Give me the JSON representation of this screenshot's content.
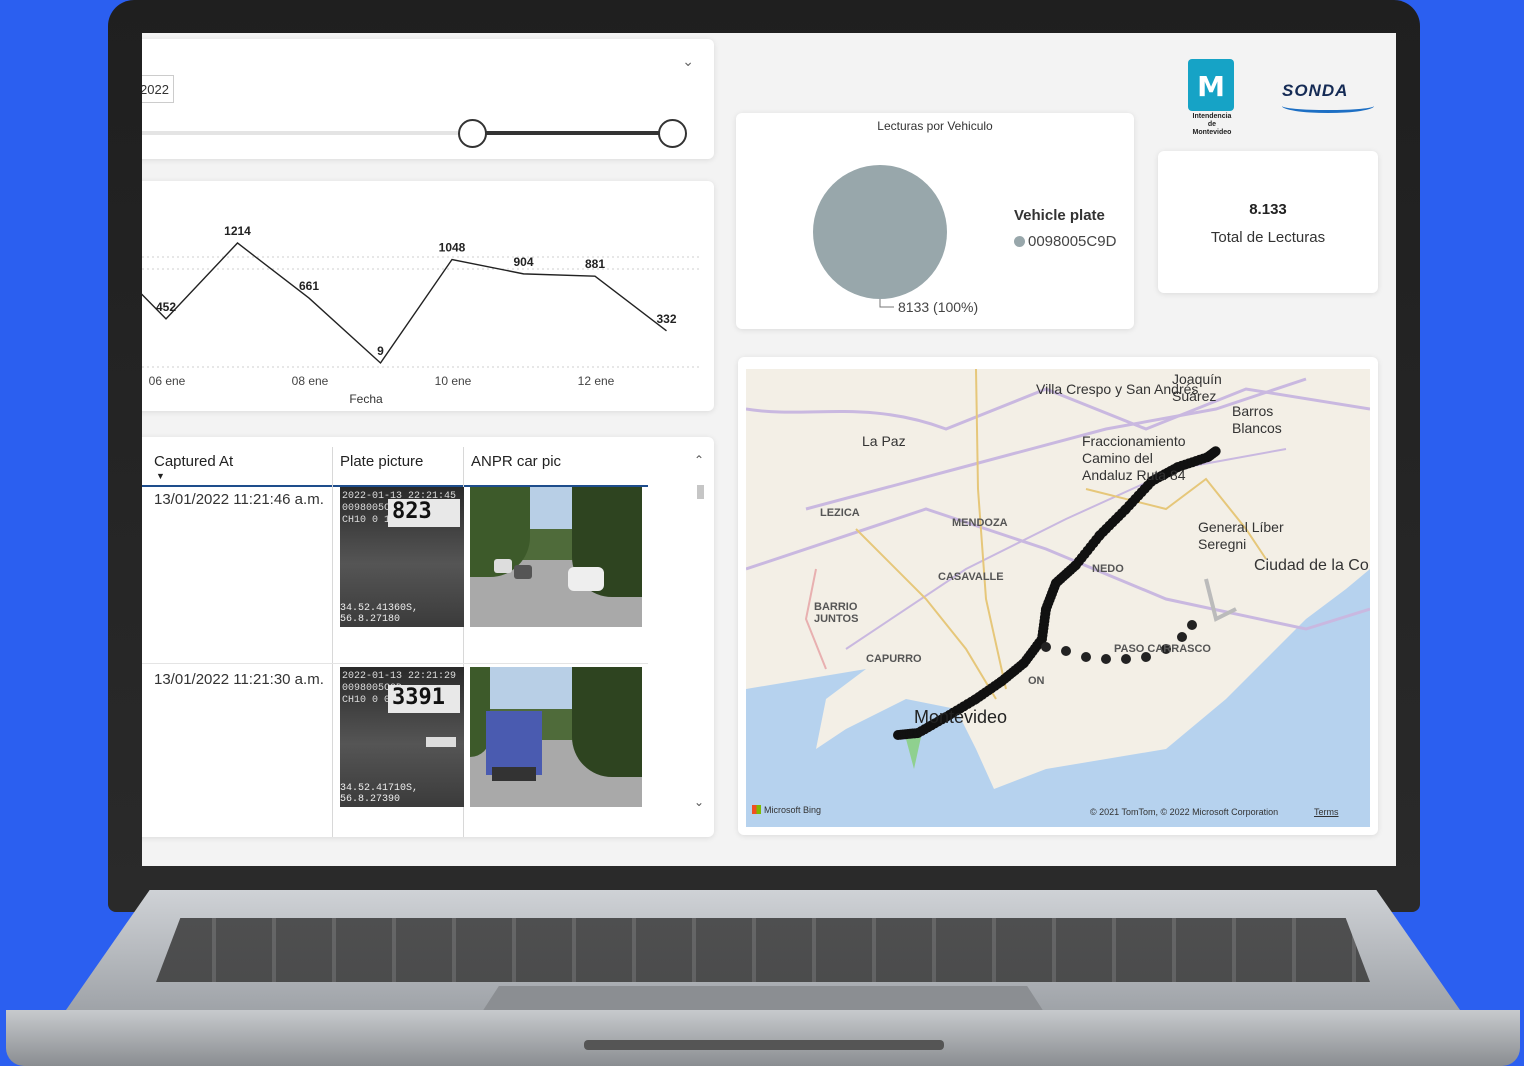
{
  "slicer": {
    "date_fragment": "2022",
    "range": {
      "start_fraction": 0.63,
      "end_fraction": 1.0
    }
  },
  "line_chart": {
    "chart_data": {
      "type": "line",
      "xlabel": "Fecha",
      "tick_labels": [
        "06 ene",
        "08 ene",
        "10 ene",
        "12 ene"
      ],
      "series": [
        {
          "values": [
            452,
            1214,
            661,
            9,
            1048,
            904,
            881,
            332
          ],
          "labels": [
            "452",
            "1214",
            "661",
            "9",
            "1048",
            "904",
            "881",
            "332"
          ]
        }
      ]
    }
  },
  "table": {
    "headers": [
      "Captured At",
      "Plate picture",
      "ANPR car pic"
    ],
    "rows": [
      {
        "captured_at": "13/01/2022 11:21:46 a.m.",
        "plate_ts": "2022-01-13 22:21:45",
        "plate_id": "0098005C9D",
        "plate_info": "CH10 0 13KM/H",
        "plate_number": "823",
        "coords": "34.52.41360S, 56.8.27180"
      },
      {
        "captured_at": "13/01/2022 11:21:30 a.m.",
        "plate_ts": "2022-01-13 22:21:29",
        "plate_id": "0098005C9D",
        "plate_info": "CH10 0 07KM/H",
        "plate_number": "3391",
        "coords": "34.52.41710S, 56.8.27390"
      }
    ]
  },
  "pie": {
    "title": "Lecturas por Vehiculo",
    "legend_title": "Vehicle plate",
    "legend_item": "0098005C9D",
    "slice_label": "8133 (100%)",
    "color": "#98a7ab"
  },
  "kpi": {
    "value": "8.133",
    "label": "Total de Lecturas"
  },
  "logos": {
    "im_letter": "M",
    "im_caption": "Intendencia de Montevideo",
    "sonda": "SONDA"
  },
  "map": {
    "labels": {
      "villa_crespo": "Villa Crespo y San Andrés",
      "joaquin": "Joaquín Suárez",
      "barros": "Barros Blancos",
      "lapaz": "La Paz",
      "fracc": "Fraccionamiento Camino del Andaluz Ruta 84",
      "lezica": "LEZICA",
      "mendoza": "MENDOZA",
      "general": "General Líber Seregni",
      "ciudad": "Ciudad de la Co",
      "casavalle": "CASAVALLE",
      "barrio": "BARRIO JUNTOS",
      "capurro": "CAPURRO",
      "paso": "PASO CARRASCO",
      "montevideo": "Montevideo",
      "nedo": "NEDO",
      "on": "ON"
    },
    "credit_bing": "Microsoft Bing",
    "credit_copyright": "© 2021 TomTom, © 2022 Microsoft Corporation",
    "credit_terms": "Terms"
  }
}
